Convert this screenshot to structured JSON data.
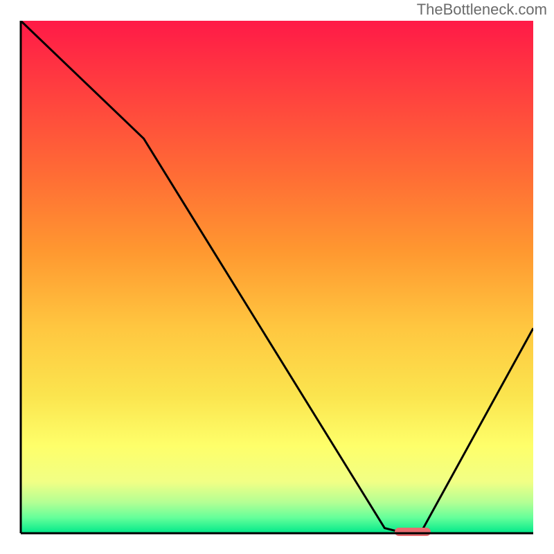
{
  "watermark": "TheBottleneck.com",
  "chart_data": {
    "type": "line",
    "title": "",
    "xlabel": "",
    "ylabel": "",
    "xlim": [
      0,
      100
    ],
    "ylim": [
      0,
      100
    ],
    "x": [
      0,
      24,
      71,
      75,
      78,
      100
    ],
    "values": [
      100,
      77,
      1,
      0,
      0,
      40
    ],
    "gradient_colors": [
      "#ff1a47",
      "#ff3b40",
      "#ff6c35",
      "#ff9830",
      "#ffc740",
      "#fbe44e",
      "#feff6a",
      "#f1ff85",
      "#b3ff94",
      "#64ff9a",
      "#00e88a"
    ],
    "optimal_marker": {
      "x_start": 73,
      "x_end": 80,
      "y": 0,
      "color": "#e96b70"
    }
  }
}
